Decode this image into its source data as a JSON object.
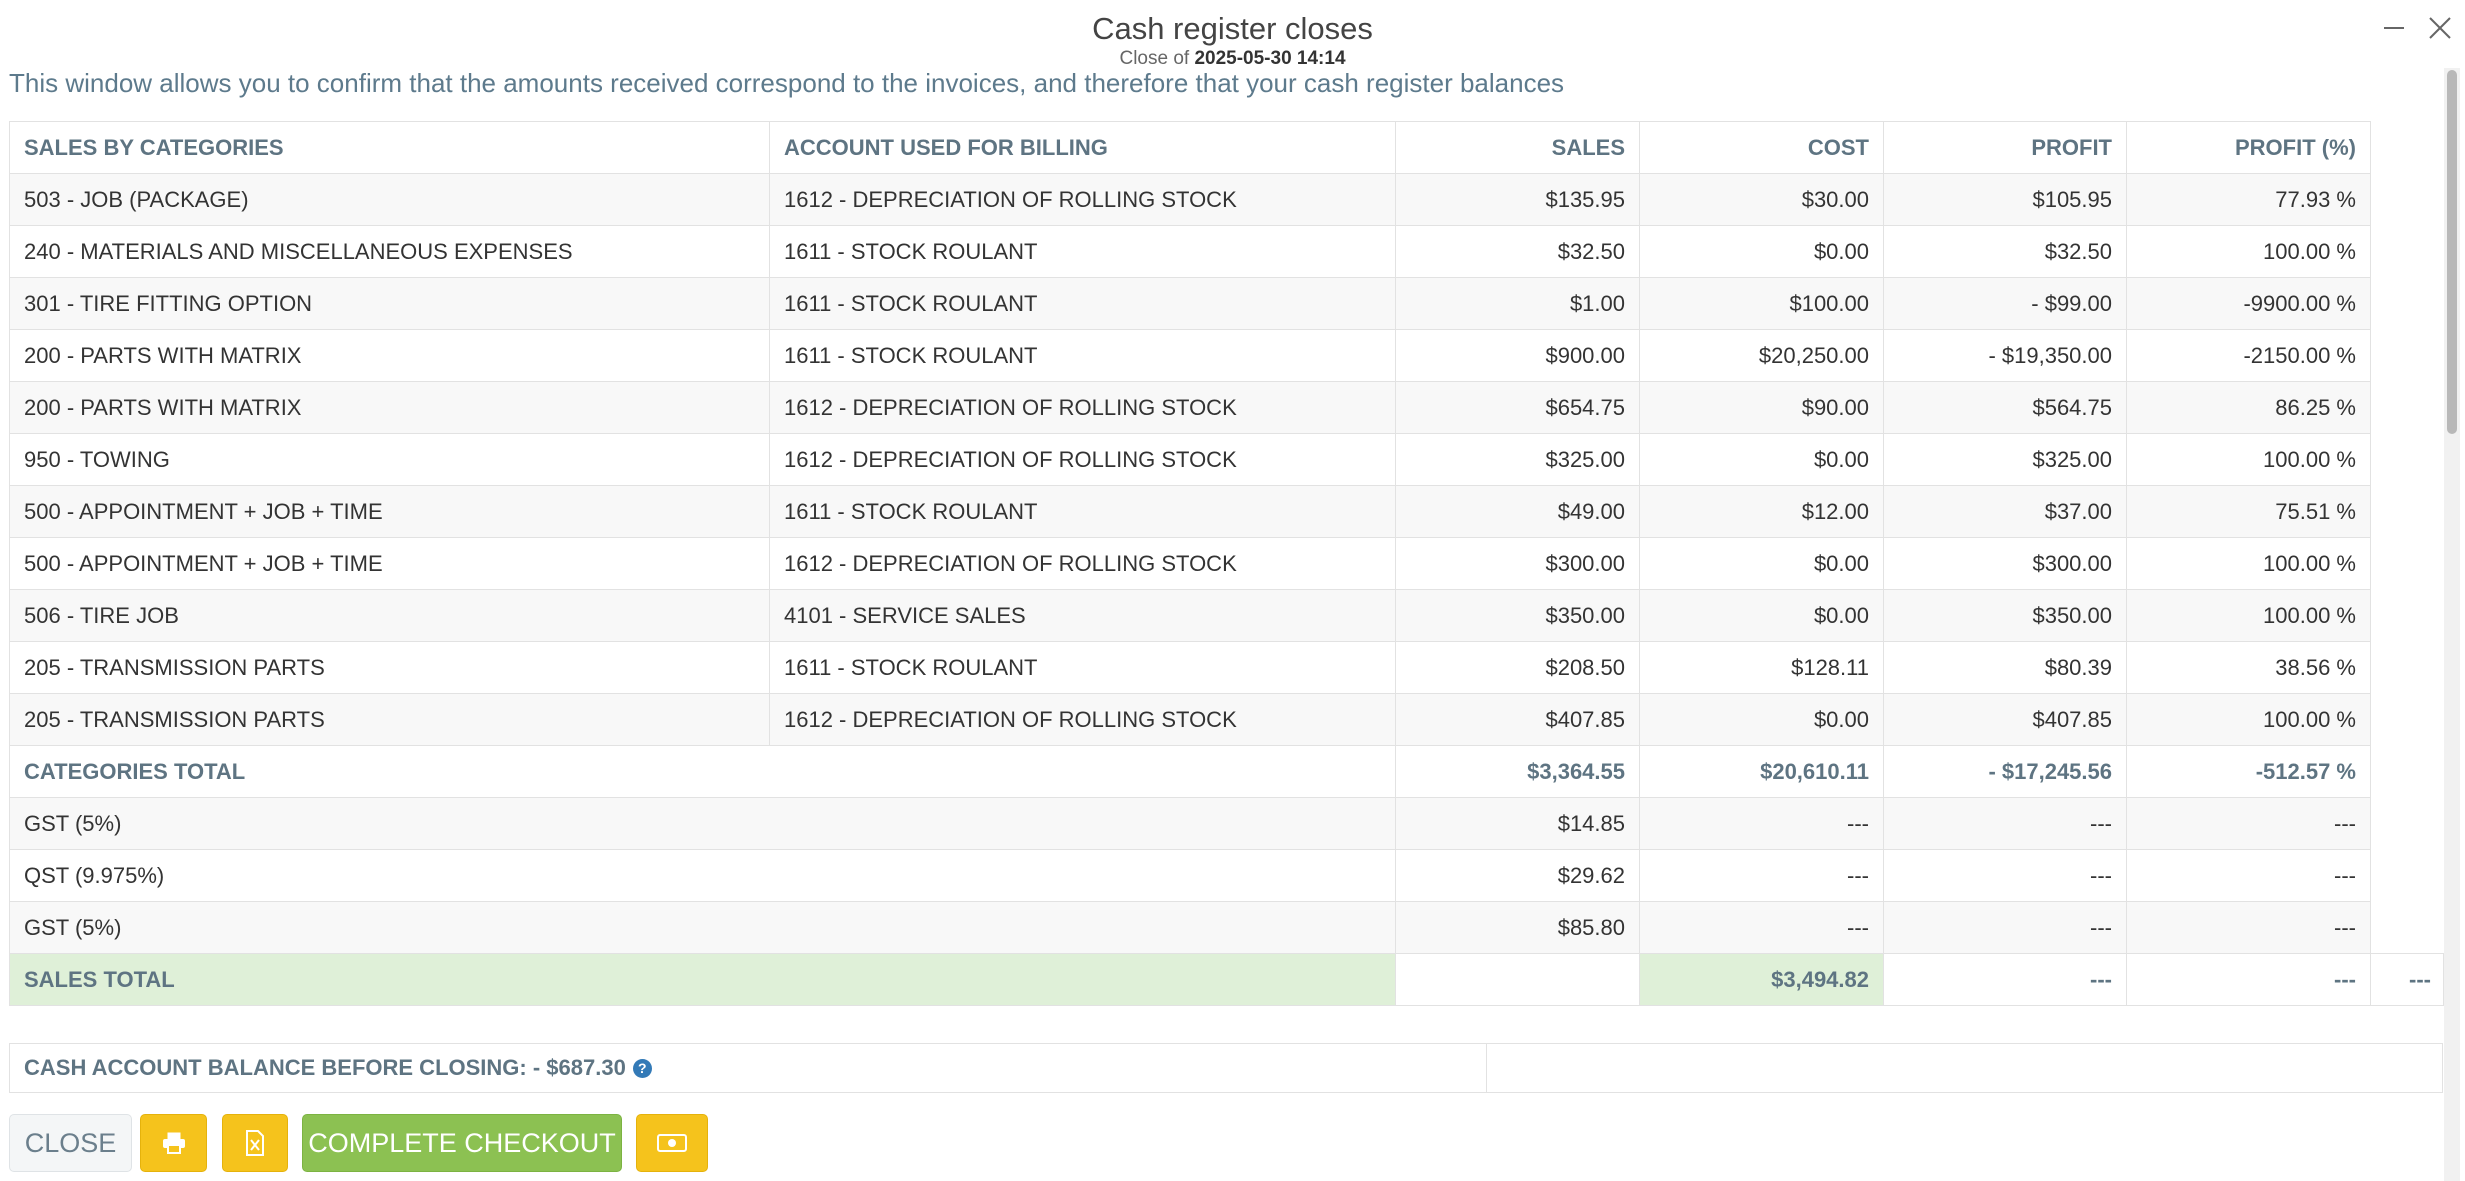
{
  "window": {
    "title": "Cash register closes",
    "subtitle_prefix": "Close of",
    "subtitle_date": "2025-05-30 14:14"
  },
  "intro": "This window allows you to confirm that the amounts received correspond to the invoices, and therefore that your cash register balances",
  "table": {
    "headers": [
      "SALES BY CATEGORIES",
      "ACCOUNT USED FOR BILLING",
      "SALES",
      "COST",
      "PROFIT",
      "PROFIT (%)"
    ],
    "rows": [
      [
        "503 - JOB (PACKAGE)",
        "1612 - DEPRECIATION OF ROLLING STOCK",
        "$135.95",
        "$30.00",
        "$105.95",
        "77.93 %"
      ],
      [
        "240 - MATERIALS AND MISCELLANEOUS EXPENSES",
        "1611 - STOCK ROULANT",
        "$32.50",
        "$0.00",
        "$32.50",
        "100.00 %"
      ],
      [
        "301 - TIRE FITTING OPTION",
        "1611 - STOCK ROULANT",
        "$1.00",
        "$100.00",
        "- $99.00",
        "-9900.00 %"
      ],
      [
        "200 - PARTS WITH MATRIX",
        "1611 - STOCK ROULANT",
        "$900.00",
        "$20,250.00",
        "- $19,350.00",
        "-2150.00 %"
      ],
      [
        "200 - PARTS WITH MATRIX",
        "1612 - DEPRECIATION OF ROLLING STOCK",
        "$654.75",
        "$90.00",
        "$564.75",
        "86.25 %"
      ],
      [
        "950 - TOWING",
        "1612 - DEPRECIATION OF ROLLING STOCK",
        "$325.00",
        "$0.00",
        "$325.00",
        "100.00 %"
      ],
      [
        "500 - APPOINTMENT + JOB + TIME",
        "1611 - STOCK ROULANT",
        "$49.00",
        "$12.00",
        "$37.00",
        "75.51 %"
      ],
      [
        "500 - APPOINTMENT + JOB + TIME",
        "1612 - DEPRECIATION OF ROLLING STOCK",
        "$300.00",
        "$0.00",
        "$300.00",
        "100.00 %"
      ],
      [
        "506 - TIRE JOB",
        "4101 - SERVICE SALES",
        "$350.00",
        "$0.00",
        "$350.00",
        "100.00 %"
      ],
      [
        "205 - TRANSMISSION PARTS",
        "1611 - STOCK ROULANT",
        "$208.50",
        "$128.11",
        "$80.39",
        "38.56 %"
      ],
      [
        "205 - TRANSMISSION PARTS",
        "1612 - DEPRECIATION OF ROLLING STOCK",
        "$407.85",
        "$0.00",
        "$407.85",
        "100.00 %"
      ]
    ],
    "categories_total": {
      "label": "CATEGORIES TOTAL",
      "sales": "$3,364.55",
      "cost": "$20,610.11",
      "profit": "- $17,245.56",
      "profit_pct": "-512.57 %"
    },
    "taxes": [
      {
        "label": "GST (5%)",
        "sales": "$14.85",
        "cost": "---",
        "profit": "---",
        "profit_pct": "---"
      },
      {
        "label": "QST (9.975%)",
        "sales": "$29.62",
        "cost": "---",
        "profit": "---",
        "profit_pct": "---"
      },
      {
        "label": "GST (5%)",
        "sales": "$85.80",
        "cost": "---",
        "profit": "---",
        "profit_pct": "---"
      }
    ],
    "sales_total": {
      "label": "SALES TOTAL",
      "amount": "$3,494.82",
      "profit": "---",
      "profit_pct": "---",
      "extra": "---"
    }
  },
  "balance": {
    "label": "CASH ACCOUNT BALANCE BEFORE CLOSING: - $687.30",
    "help_icon": "question-circle-icon"
  },
  "buttons": {
    "close": "CLOSE",
    "print_icon": "print-icon",
    "excel_icon": "excel-icon",
    "complete": "COMPLETE CHECKOUT",
    "cash_icon": "cash-icon"
  },
  "colors": {
    "accent_label": "#5e7482",
    "yellow_button": "#f5c31c",
    "green_button": "#8cc152",
    "sales_total_bg": "#dff0d8",
    "help_icon": "#337ab7"
  }
}
